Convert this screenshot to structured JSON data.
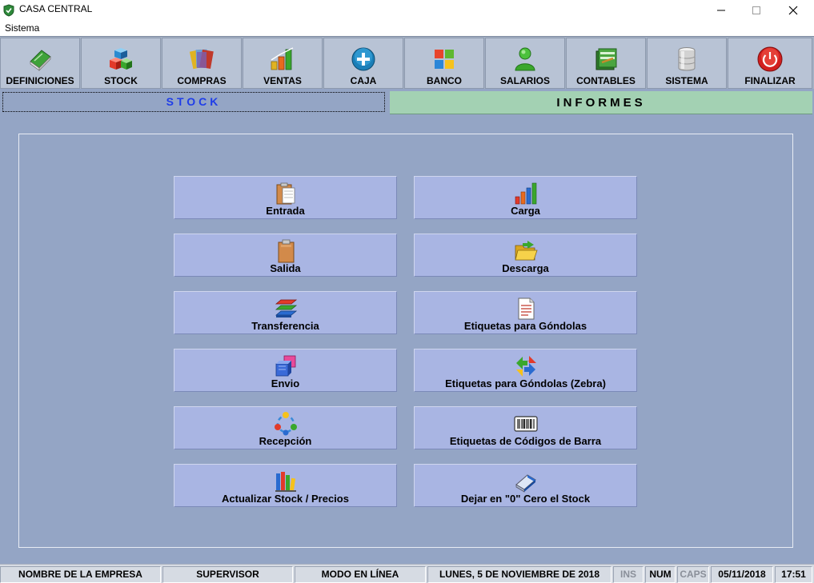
{
  "window": {
    "title": "CASA CENTRAL"
  },
  "menu": {
    "sistema": "Sistema"
  },
  "toolbar": {
    "items": [
      {
        "label": "DEFINICIONES",
        "icon": "book-icon"
      },
      {
        "label": "STOCK",
        "icon": "boxes-icon"
      },
      {
        "label": "COMPRAS",
        "icon": "cards-icon"
      },
      {
        "label": "VENTAS",
        "icon": "bar-chart-icon"
      },
      {
        "label": "CAJA",
        "icon": "plus-circle-icon"
      },
      {
        "label": "BANCO",
        "icon": "windows-icon"
      },
      {
        "label": "SALARIOS",
        "icon": "person-icon"
      },
      {
        "label": "CONTABLES",
        "icon": "ledger-icon"
      },
      {
        "label": "SISTEMA",
        "icon": "database-icon"
      },
      {
        "label": "FINALIZAR",
        "icon": "power-icon"
      }
    ]
  },
  "tabs": {
    "stock": "STOCK",
    "informes": "INFORMES"
  },
  "actions": {
    "left": [
      {
        "label": "Entrada",
        "icon": "clipboard-in-icon"
      },
      {
        "label": "Salida",
        "icon": "clipboard-icon"
      },
      {
        "label": "Transferencia",
        "icon": "layers-icon"
      },
      {
        "label": "Envio",
        "icon": "cubes-icon"
      },
      {
        "label": "Recepción",
        "icon": "cycle-icon"
      },
      {
        "label": "Actualizar Stock / Precios",
        "icon": "books-icon"
      }
    ],
    "right": [
      {
        "label": "Carga",
        "icon": "bar-chart-icon"
      },
      {
        "label": "Descarga",
        "icon": "folder-open-icon"
      },
      {
        "label": "Etiquetas para Góndolas",
        "icon": "document-icon"
      },
      {
        "label": "Etiquetas para Góndolas (Zebra)",
        "icon": "arrows-icon"
      },
      {
        "label": "Etiquetas de Códigos de Barra",
        "icon": "barcode-icon"
      },
      {
        "label": "Dejar en \"0\" Cero el Stock",
        "icon": "eraser-icon"
      }
    ]
  },
  "status": {
    "empresa": "NOMBRE DE LA EMPRESA",
    "usuario": "SUPERVISOR",
    "modo": "MODO EN LÍNEA",
    "fecha_larga": "LUNES, 5 DE NOVIEMBRE DE 2018",
    "ins": "INS",
    "num": "NUM",
    "caps": "CAPS",
    "fecha": "05/11/2018",
    "hora": "17:51"
  },
  "colors": {
    "background": "#94a5c5",
    "toolbar": "#a4b1c5",
    "action_button": "#a9b5e3",
    "tab_active_text": "#1f3de8",
    "tab_informes": "#a3d1b3"
  }
}
